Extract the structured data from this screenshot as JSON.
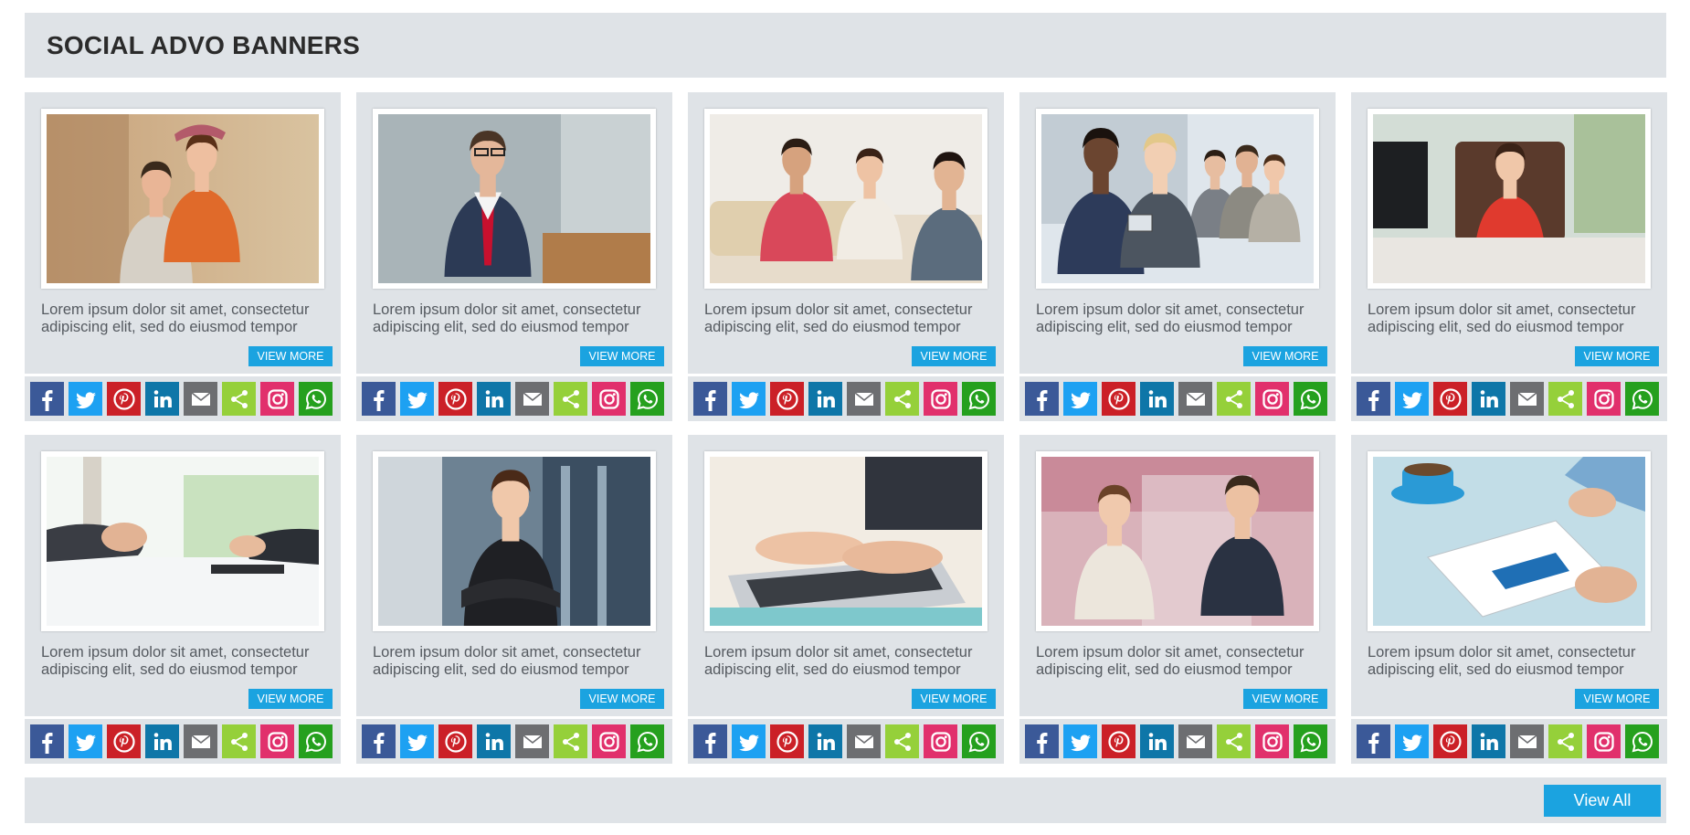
{
  "header": {
    "title": "SOCIAL ADVO BANNERS"
  },
  "colors": {
    "accent": "#1ba3e0",
    "panel": "#dfe3e7",
    "facebook": "#3b5998",
    "twitter": "#1da1f2",
    "pinterest": "#cb2027",
    "linkedin": "#0e76a8",
    "email": "#6d6e71",
    "share": "#95d03a",
    "instagram": "#e1306c",
    "whatsapp": "#25a01e"
  },
  "social_icons": [
    "facebook-icon",
    "twitter-icon",
    "pinterest-icon",
    "linkedin-icon",
    "email-icon",
    "share-icon",
    "instagram-icon",
    "whatsapp-icon"
  ],
  "cards": [
    {
      "photo": "couple-piggyback-photo",
      "text": "Lorem ipsum dolor sit amet, consectetur adipiscing elit, sed do eiusmod tempor",
      "button": "VIEW MORE"
    },
    {
      "photo": "businessman-glasses-red-tie-photo",
      "text": "Lorem ipsum dolor sit amet, consectetur adipiscing elit, sed do eiusmod tempor",
      "button": "VIEW MORE"
    },
    {
      "photo": "group-sofa-meeting-photo",
      "text": "Lorem ipsum dolor sit amet, consectetur adipiscing elit, sed do eiusmod tempor",
      "button": "VIEW MORE"
    },
    {
      "photo": "business-team-tablet-photo",
      "text": "Lorem ipsum dolor sit amet, consectetur adipiscing elit, sed do eiusmod tempor",
      "button": "VIEW MORE"
    },
    {
      "photo": "businesswoman-red-jacket-desk-photo",
      "text": "Lorem ipsum dolor sit amet, consectetur adipiscing elit, sed do eiusmod tempor",
      "button": "VIEW MORE"
    },
    {
      "photo": "hands-signing-document-photo",
      "text": "Lorem ipsum dolor sit amet, consectetur adipiscing elit, sed do eiusmod tempor",
      "button": "VIEW MORE"
    },
    {
      "photo": "businesswoman-arms-crossed-photo",
      "text": "Lorem ipsum dolor sit amet, consectetur adipiscing elit, sed do eiusmod tempor",
      "button": "VIEW MORE"
    },
    {
      "photo": "hands-typing-laptop-photo",
      "text": "Lorem ipsum dolor sit amet, consectetur adipiscing elit, sed do eiusmod tempor",
      "button": "VIEW MORE"
    },
    {
      "photo": "man-woman-talking-station-photo",
      "text": "Lorem ipsum dolor sit amet, consectetur adipiscing elit, sed do eiusmod tempor",
      "button": "VIEW MORE"
    },
    {
      "photo": "tablet-coffee-cup-photo",
      "text": "Lorem ipsum dolor sit amet, consectetur adipiscing elit, sed do eiusmod tempor",
      "button": "VIEW MORE"
    }
  ],
  "footer": {
    "view_all": "View All"
  }
}
